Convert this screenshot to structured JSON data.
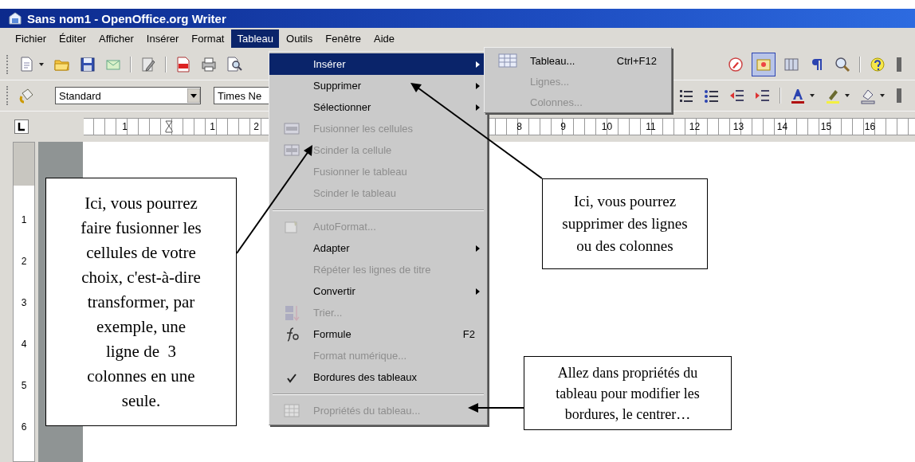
{
  "window": {
    "title": "Sans nom1 - OpenOffice.org Writer"
  },
  "menu_bar": [
    {
      "label": "Fichier",
      "selected": false
    },
    {
      "label": "Éditer",
      "selected": false
    },
    {
      "label": "Afficher",
      "selected": false
    },
    {
      "label": "Insérer",
      "selected": false
    },
    {
      "label": "Format",
      "selected": false
    },
    {
      "label": "Tableau",
      "selected": true
    },
    {
      "label": "Outils",
      "selected": false
    },
    {
      "label": "Fenêtre",
      "selected": false
    },
    {
      "label": "Aide",
      "selected": false
    }
  ],
  "format_bar": {
    "style_box": {
      "value": "Standard"
    },
    "font_box": {
      "value": "Times Ne"
    }
  },
  "ruler": {
    "left_marks": [
      "1",
      "1",
      "2"
    ],
    "right_marks": [
      "8",
      "9",
      "10",
      "11",
      "12",
      "13",
      "14",
      "15",
      "16"
    ]
  },
  "vertical_ruler": {
    "marks": [
      "1",
      "2",
      "3",
      "4",
      "5",
      "6"
    ]
  },
  "table_menu": {
    "items": [
      {
        "kind": "item",
        "label": "Insérer",
        "selected": true,
        "disabled": false,
        "submenu": true,
        "checked": false
      },
      {
        "kind": "item",
        "label": "Supprimer",
        "selected": false,
        "disabled": false,
        "submenu": true,
        "checked": false
      },
      {
        "kind": "item",
        "label": "Sélectionner",
        "selected": false,
        "disabled": false,
        "submenu": true,
        "checked": false
      },
      {
        "kind": "item",
        "label": "Fusionner les cellules",
        "selected": false,
        "disabled": true,
        "submenu": false,
        "checked": false
      },
      {
        "kind": "item",
        "label": "Scinder la cellule",
        "selected": false,
        "disabled": true,
        "submenu": false,
        "checked": false
      },
      {
        "kind": "item",
        "label": "Fusionner le tableau",
        "selected": false,
        "disabled": true,
        "submenu": false,
        "checked": false
      },
      {
        "kind": "item",
        "label": "Scinder le tableau",
        "selected": false,
        "disabled": true,
        "submenu": false,
        "checked": false
      },
      {
        "kind": "separator"
      },
      {
        "kind": "item",
        "label": "AutoFormat...",
        "selected": false,
        "disabled": true,
        "submenu": false,
        "checked": false
      },
      {
        "kind": "item",
        "label": "Adapter",
        "selected": false,
        "disabled": false,
        "submenu": true,
        "checked": false
      },
      {
        "kind": "item",
        "label": "Répéter les lignes de titre",
        "selected": false,
        "disabled": true,
        "submenu": false,
        "checked": false
      },
      {
        "kind": "item",
        "label": "Convertir",
        "selected": false,
        "disabled": false,
        "submenu": true,
        "checked": false
      },
      {
        "kind": "item",
        "label": "Trier...",
        "selected": false,
        "disabled": true,
        "submenu": false,
        "checked": false
      },
      {
        "kind": "item",
        "label": "Formule",
        "shortcut": "F2",
        "selected": false,
        "disabled": false,
        "submenu": false,
        "checked": false
      },
      {
        "kind": "item",
        "label": "Format numérique...",
        "selected": false,
        "disabled": true,
        "submenu": false,
        "checked": false
      },
      {
        "kind": "item",
        "label": "Bordures des tableaux",
        "selected": false,
        "disabled": false,
        "submenu": false,
        "checked": true
      },
      {
        "kind": "separator"
      },
      {
        "kind": "item",
        "label": "Propriétés du tableau...",
        "selected": false,
        "disabled": true,
        "submenu": false,
        "checked": false
      }
    ]
  },
  "insert_submenu": {
    "items": [
      {
        "label": "Tableau...",
        "shortcut": "Ctrl+F12",
        "disabled": false
      },
      {
        "label": "Lignes...",
        "disabled": true
      },
      {
        "label": "Colonnes...",
        "disabled": true
      }
    ]
  },
  "callouts": [
    {
      "text": "Ici, vous pourrez\nfaire fusionner les\ncellules de votre\nchoix, c'est-à-dire\ntransformer, par\nexemple, une\nligne de  3\ncolonnes en une\nseule."
    },
    {
      "text": "Ici, vous pourrez\nsupprimer des lignes\nou des colonnes"
    },
    {
      "text": "Allez dans propriétés du\ntableau pour modifier les\nbordures, le centrer…"
    }
  ]
}
